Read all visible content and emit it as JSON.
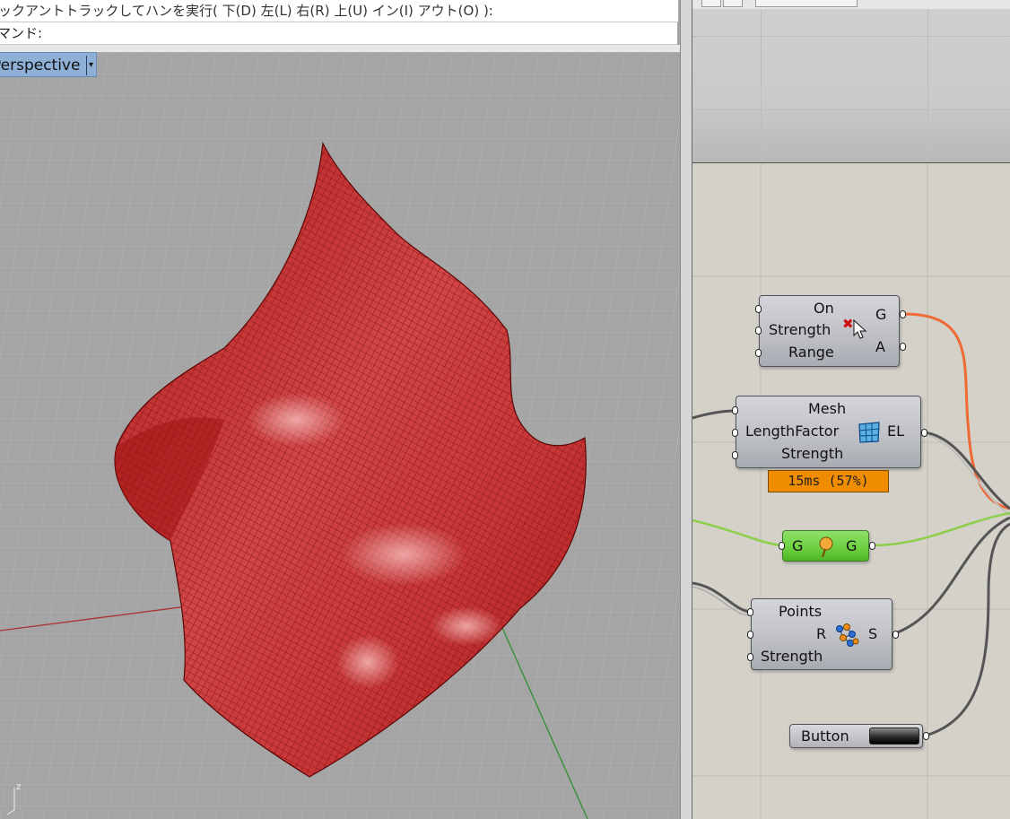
{
  "rhino": {
    "command_history": "ックアントトラックしてハンを実行( 下(D) 左(L) 右(R) 上(U) イン(I) アウト(O) ):",
    "command_prompt": "マンド:",
    "viewport_tab_label": "Perspective",
    "viewport_tab_dropdown": "▾",
    "axis_label_z": "z",
    "mesh_color": "#c62828"
  },
  "grasshopper": {
    "gravity_component": {
      "inputs": [
        "On",
        "Strength",
        "Range"
      ],
      "outputs": [
        "G",
        "A"
      ],
      "error_marker": "✖"
    },
    "edge_length_component": {
      "inputs": [
        "Mesh",
        "LengthFactor",
        "Strength"
      ],
      "outputs": [
        "EL"
      ],
      "timer_text": "15ms (57%)"
    },
    "goal_object_component": {
      "input": "G",
      "output": "G"
    },
    "anchor_component": {
      "inputs": [
        "Points",
        "R",
        "Strength"
      ],
      "outputs": [
        "S"
      ]
    },
    "button_component": {
      "label": "Button"
    },
    "wire_colors": {
      "default": "#555555",
      "selected_orange": "#f06a36",
      "green": "#8ccf4a"
    }
  }
}
